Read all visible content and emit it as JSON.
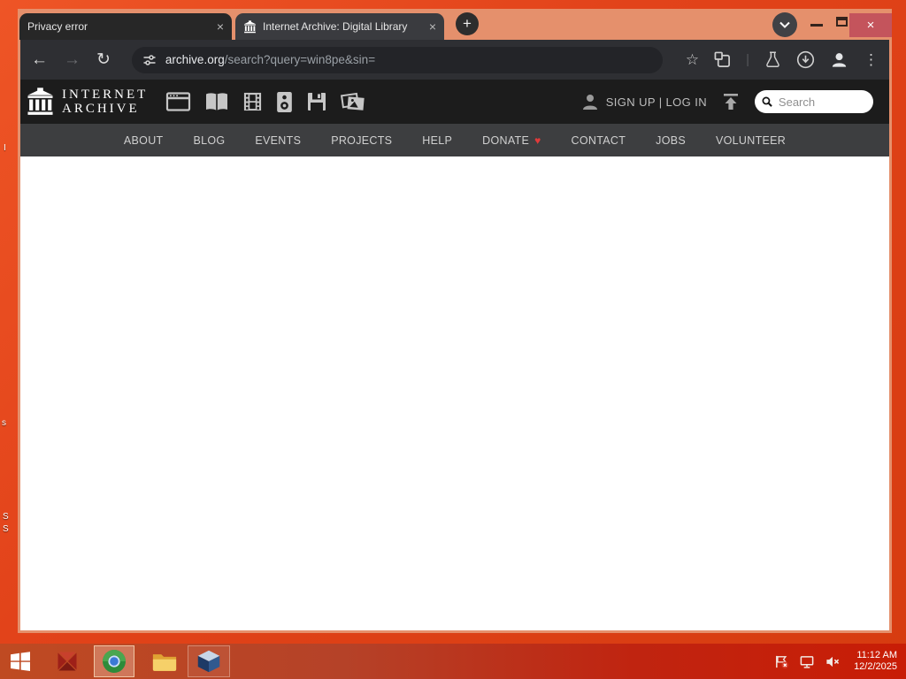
{
  "browser": {
    "tabs": [
      {
        "title": "Privacy error"
      },
      {
        "title": "Internet Archive: Digital Library"
      }
    ],
    "url": {
      "host": "archive.org",
      "path": "/search?query=win8pe&sin="
    }
  },
  "icons": {
    "close_tab": "×",
    "new_tab": "+",
    "back": "←",
    "forward": "→",
    "reload": "↻",
    "star": "☆",
    "kebab": "⋮",
    "separator": "|",
    "window_close": "×",
    "heart": "♥"
  },
  "archive": {
    "logo_line1": "INTERNET",
    "logo_line2": "ARCHIVE",
    "auth_text": "SIGN UP | LOG IN",
    "search_placeholder": "Search",
    "nav": [
      "ABOUT",
      "BLOG",
      "EVENTS",
      "PROJECTS",
      "HELP",
      "DONATE",
      "CONTACT",
      "JOBS",
      "VOLUNTEER"
    ]
  },
  "taskbar": {
    "time": "11:12 AM",
    "date": "12/2/2025"
  },
  "desktop": {
    "fragments": [
      "I",
      "s",
      "S",
      "S"
    ]
  },
  "colors": {
    "titlebar": "#e5906c",
    "desktop": "#e2431a",
    "taskbar_left": "#bf4a22",
    "taskbar_right": "#c81d06",
    "close_button": "#c4545c",
    "donate_heart": "#e03a3a"
  }
}
